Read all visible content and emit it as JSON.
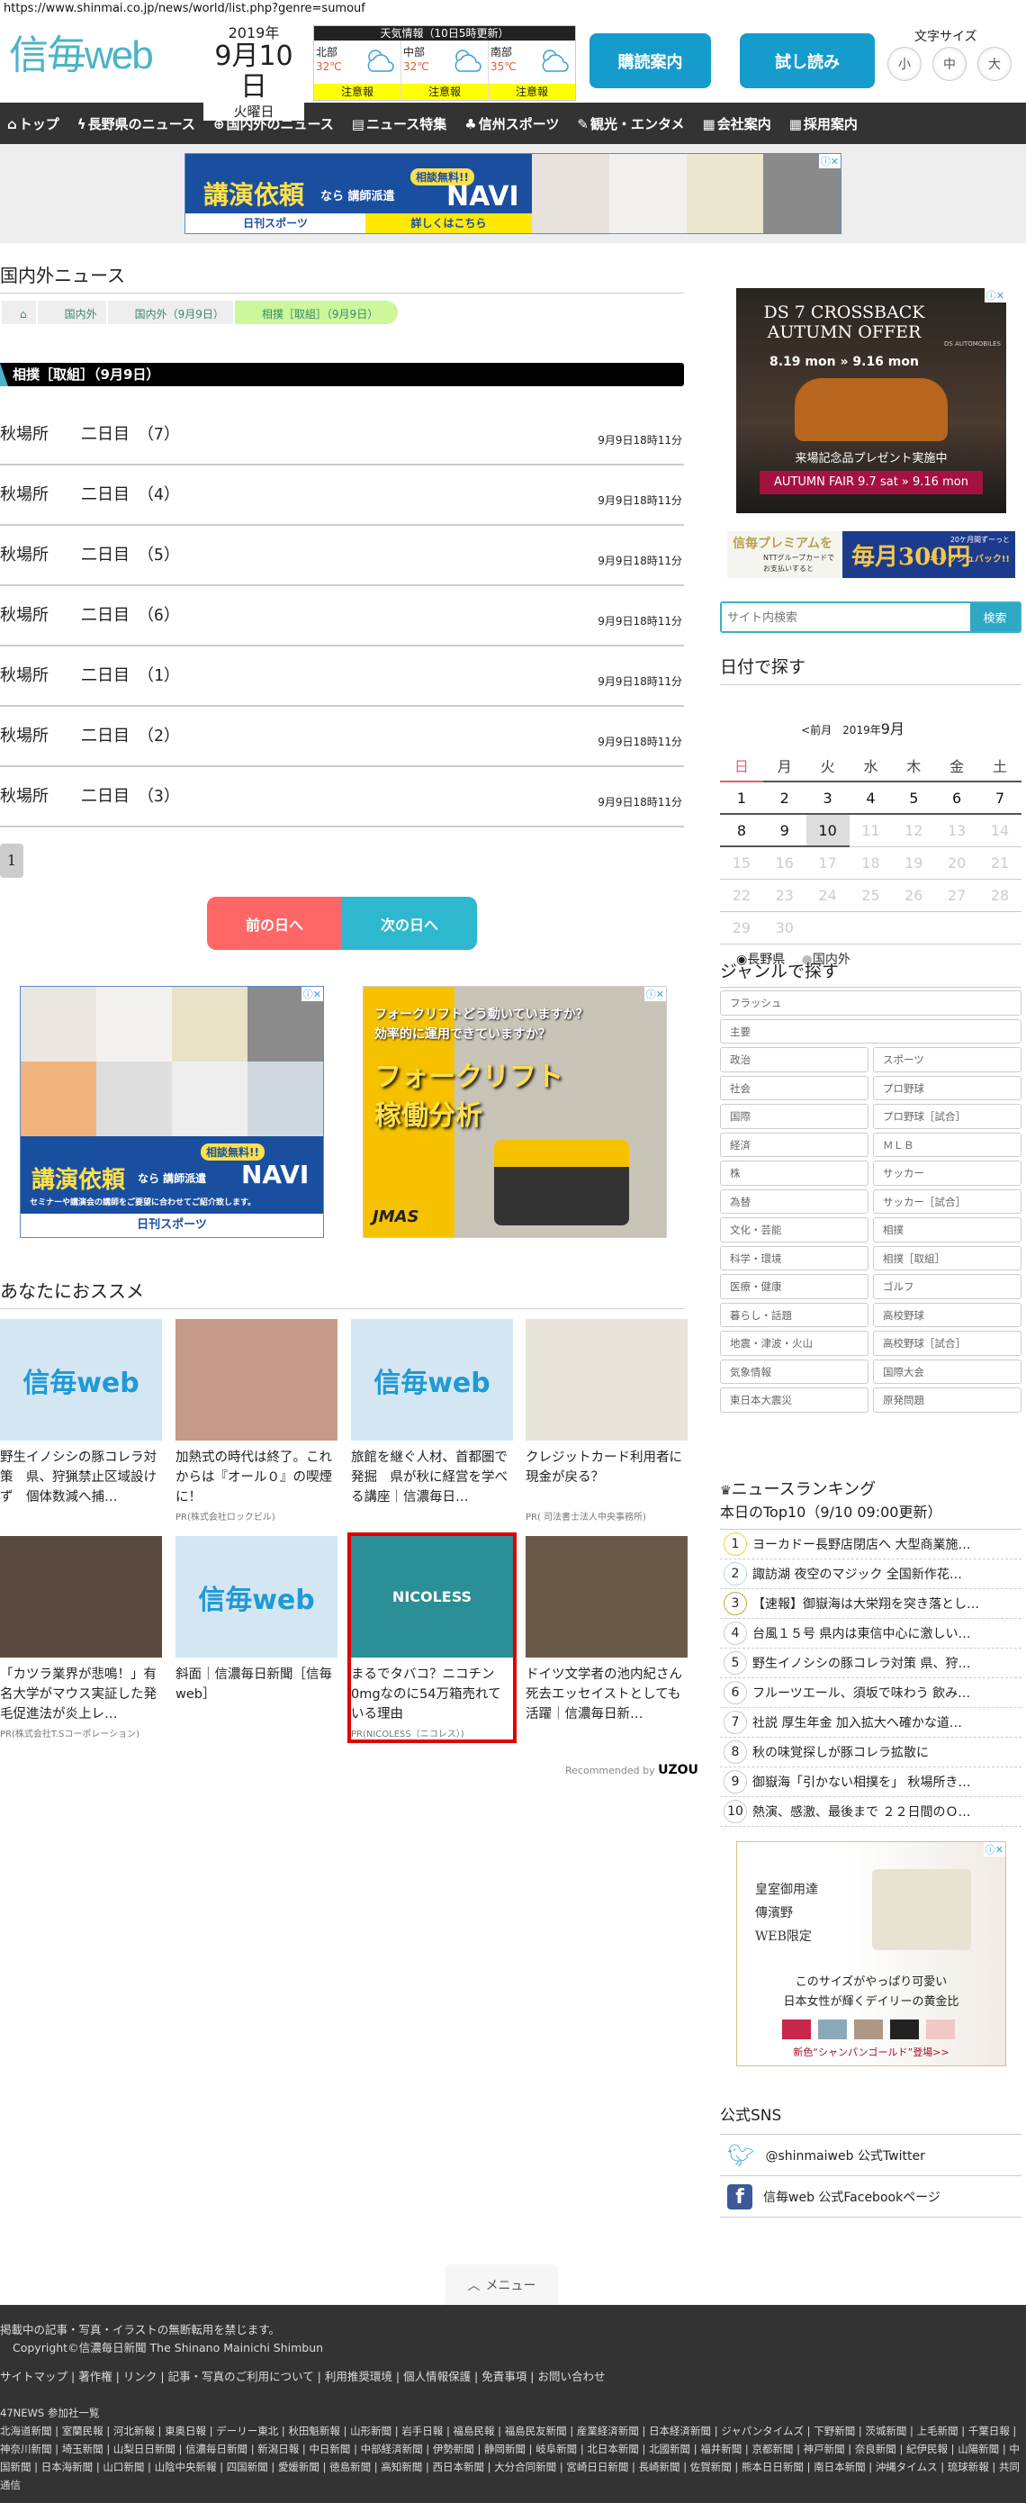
{
  "url": "https://www.shinmai.co.jp/news/world/list.php?genre=sumouf",
  "header": {
    "logo": "信毎web",
    "year": "2019年",
    "date": "9月10日",
    "weekday": "火曜日",
    "weather": {
      "title": "天気情報（10日5時更新）",
      "regions": [
        {
          "name": "北部",
          "temp": "32℃",
          "warning": "注意報"
        },
        {
          "name": "中部",
          "temp": "32℃",
          "warning": "注意報"
        },
        {
          "name": "南部",
          "temp": "35℃",
          "warning": "注意報"
        }
      ]
    },
    "subscribe": "購読案内",
    "trial": "試し読み",
    "font_size_label": "文字サイズ",
    "font_sizes": [
      "小",
      "中",
      "大"
    ]
  },
  "nav": [
    "トップ",
    "長野県のニュース",
    "国内外のニュース",
    "ニュース特集",
    "信州スポーツ",
    "観光・エンタメ",
    "会社案内",
    "採用案内"
  ],
  "ads": {
    "top": {
      "headline": "講演依頼",
      "mid": "なら 講師派遣",
      "brand": "NAVI",
      "badge": "相談無料!!",
      "sponsor": "日刊スポーツ",
      "cta": "詳しくはこちら"
    },
    "navi_sq": {
      "headline": "講演依頼",
      "mid": "なら 講師派遣",
      "brand": "NAVI",
      "badge": "相談無料!!",
      "sub": "セミナーや講演会の講師をご要望に合わせてご紹介致します。",
      "sponsor": "日刊スポーツ"
    },
    "jmas": {
      "q1": "フォークリフトどう動いていますか？",
      "q2": "効率的に運用できていますか？",
      "title1": "フォークリフト",
      "title2": "稼働分析",
      "brand": "JMAS"
    },
    "ds": {
      "title1": "DS 7 CROSSBACK",
      "title2": "AUTUMN OFFER",
      "dates": "8.19 mon » 9.16 mon",
      "brand": "DS AUTOMOBILES",
      "promo": "来場記念品プレゼント実施中",
      "fair": "AUTUMN FAIR 9.7 sat » 9.16 mon"
    },
    "premium": {
      "left": "信毎プレミアムを",
      "sub1": "NTTグループカードで",
      "sub2": "お支払いすると",
      "big": "毎月300円",
      "right1": "20ケ月間ずーっと",
      "right2": "キャッシュバック!!"
    },
    "bag": {
      "l1": "皇室御用達",
      "l2": "傳濱野",
      "l3": "WEB限定",
      "c1": "このサイズがやっぱり可愛い",
      "c2": "日本女性が輝くデイリーの黄金比",
      "new": "新色“シャンパンゴールド”登場>>"
    }
  },
  "main": {
    "title": "国内外ニュース",
    "breadcrumb": [
      "国内外",
      "国内外（9月9日）",
      "相撲［取組］（9月9日）"
    ],
    "section": "相撲［取組］（9月9日）",
    "news": [
      {
        "title": "秋場所　　二日目　（7）",
        "time": "9月9日18時11分"
      },
      {
        "title": "秋場所　　二日目　（4）",
        "time": "9月9日18時11分"
      },
      {
        "title": "秋場所　　二日目　（5）",
        "time": "9月9日18時11分"
      },
      {
        "title": "秋場所　　二日目　（6）",
        "time": "9月9日18時11分"
      },
      {
        "title": "秋場所　　二日目　（1）",
        "time": "9月9日18時11分"
      },
      {
        "title": "秋場所　　二日目　（2）",
        "time": "9月9日18時11分"
      },
      {
        "title": "秋場所　　二日目　（3）",
        "time": "9月9日18時11分"
      }
    ],
    "page": "1",
    "prev": "前の日へ",
    "next": "次の日へ"
  },
  "recommend": {
    "title": "あなたにおススメ",
    "items": [
      {
        "text": "野生イノシシの豚コレラ対策　県、狩猟禁止区域設けず　個体数減へ捕…",
        "pr": "",
        "img": "信毎web"
      },
      {
        "text": "加熱式の時代は終了。これからは『オール０』の喫煙に！",
        "pr": "PR(株式会社ロックビル)",
        "img": ""
      },
      {
        "text": "旅館を継ぐ人材、首都圏で発掘　県が秋に経営を学べる講座｜信濃毎日…",
        "pr": "",
        "img": "信毎web"
      },
      {
        "text": "クレジットカード利用者に現金が戻る？",
        "pr": "PR( 司法書士法人中央事務所)",
        "img": ""
      },
      {
        "text": "「カツラ業界が悲鳴！」有名大学がマウス実証した発毛促進法が炎上レ…",
        "pr": "PR(株式会社T.Sコーポレーション)",
        "img": ""
      },
      {
        "text": "斜面｜信濃毎日新聞［信毎web］",
        "pr": "",
        "img": "信毎web"
      },
      {
        "text": "まるでタバコ？ニコチン0mgなのに54万箱売れている理由",
        "pr": "PR(NICOLESS（ニコレス）)",
        "img": "NICOLESS"
      },
      {
        "text": "ドイツ文学者の池内紀さん死去エッセイストとしても活躍｜信濃毎日新…",
        "pr": "",
        "img": ""
      }
    ],
    "credit": "Recommended by",
    "credit_brand": "UZOU"
  },
  "sidebar": {
    "search_placeholder": "サイト内検索",
    "search_button": "検索",
    "date_title": "日付で探す",
    "prev_month": "<前月",
    "month": "9月",
    "year": "2019年",
    "weekdays": [
      "日",
      "月",
      "火",
      "水",
      "木",
      "金",
      "土"
    ],
    "weeks": [
      [
        "1",
        "2",
        "3",
        "4",
        "5",
        "6",
        "7"
      ],
      [
        "8",
        "9",
        "10",
        "11",
        "12",
        "13",
        "14"
      ],
      [
        "15",
        "16",
        "17",
        "18",
        "19",
        "20",
        "21"
      ],
      [
        "22",
        "23",
        "24",
        "25",
        "26",
        "27",
        "28"
      ],
      [
        "29",
        "30",
        "",
        "",
        "",
        "",
        ""
      ]
    ],
    "radio": [
      "長野県",
      "国内外"
    ],
    "genre_title": "ジャンルで探す",
    "genres_full": [
      "フラッシュ",
      "主要"
    ],
    "genres": [
      "政治",
      "スポーツ",
      "社会",
      "プロ野球",
      "国際",
      "プロ野球［試合］",
      "経済",
      "ＭＬＢ",
      "株",
      "サッカー",
      "為替",
      "サッカー［試合］",
      "文化・芸能",
      "相撲",
      "科学・環境",
      "相撲［取組］",
      "医療・健康",
      "ゴルフ",
      "暮らし・話題",
      "高校野球",
      "地震・津波・火山",
      "高校野球［試合］",
      "気象情報",
      "国際大会",
      "東日本大震災",
      "原発問題"
    ],
    "ranking_title": "ニュースランキング",
    "ranking_sub": "本日のTop10（9/10 09:00更新）",
    "ranking": [
      "ヨーカドー長野店閉店へ 大型商業施…",
      "諏訪湖 夜空のマジック 全国新作花…",
      "【速報】御嶽海は大栄翔を突き落とし…",
      "台風１５号 県内は東信中心に激しい…",
      "野生イノシシの豚コレラ対策 県、狩…",
      "フルーツエール、須坂で味わう 飲み…",
      "社説 厚生年金 加入拡大へ確かな道…",
      "秋の味覚探しが豚コレラ拡散に",
      "御嶽海「引かない相撲を」 秋場所き…",
      "熱演、感激、最後まで ２２日間のＯ…"
    ],
    "sns_title": "公式SNS",
    "twitter": "@shinmaiweb 公式Twitter",
    "facebook": "信毎web 公式Facebookページ"
  },
  "menu": "メニュー",
  "footer": {
    "notice": "掲載中の記事・写真・イラストの無断転用を禁じます。",
    "copyright": "Copyright©信濃毎日新聞 The Shinano Mainichi Shimbun",
    "links": [
      "サイトマップ",
      "著作権",
      "リンク",
      "記事・写真のご利用について",
      "利用推奨環境",
      "個人情報保護",
      "免責事項",
      "お問い合わせ"
    ],
    "p47_title": "47NEWS 参加社一覧",
    "p47": [
      "北海道新聞",
      "室蘭民報",
      "河北新報",
      "東奥日報",
      "デーリー東北",
      "秋田魁新報",
      "山形新聞",
      "岩手日報",
      "福島民報",
      "福島民友新聞",
      "産業経済新聞",
      "日本経済新聞",
      "ジャパンタイムズ",
      "下野新聞",
      "茨城新聞",
      "上毛新聞",
      "千葉日報",
      "神奈川新聞",
      "埼玉新聞",
      "山梨日日新聞",
      "信濃毎日新聞",
      "新潟日報",
      "中日新聞",
      "中部経済新聞",
      "伊勢新聞",
      "静岡新聞",
      "岐阜新聞",
      "北日本新聞",
      "北國新聞",
      "福井新聞",
      "京都新聞",
      "神戸新聞",
      "奈良新聞",
      "紀伊民報",
      "山陽新聞",
      "中国新聞",
      "日本海新聞",
      "山口新聞",
      "山陰中央新報",
      "四国新聞",
      "愛媛新聞",
      "徳島新聞",
      "高知新聞",
      "西日本新聞",
      "大分合同新聞",
      "宮崎日日新聞",
      "長崎新聞",
      "佐賀新聞",
      "熊本日日新聞",
      "南日本新聞",
      "沖縄タイムス",
      "琉球新報",
      "共同通信"
    ]
  },
  "colors": {
    "brand": "#4bb3c8",
    "button": "#169ccc",
    "prev": "#ff6666",
    "next": "#2eb8d0",
    "nav": "#333333",
    "footer": "#333333"
  }
}
